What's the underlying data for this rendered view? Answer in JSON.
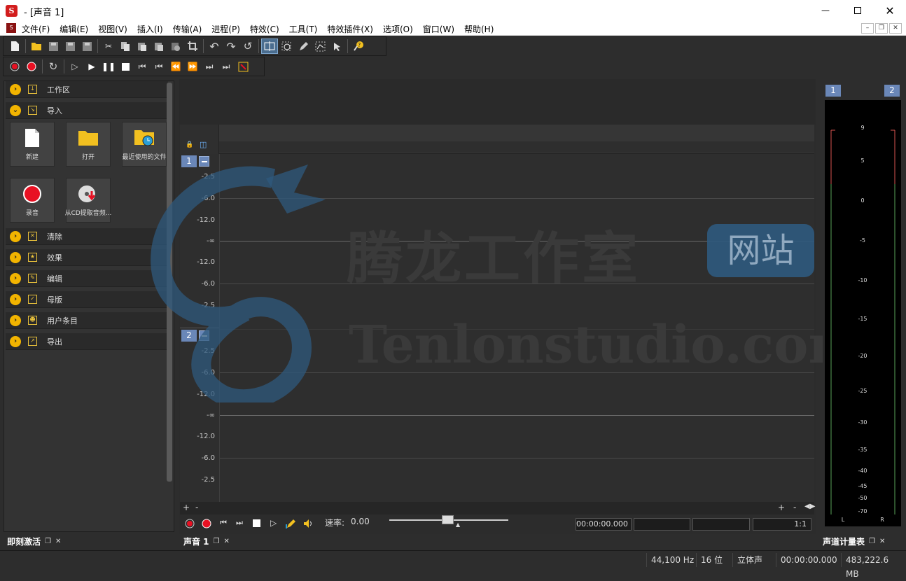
{
  "window": {
    "title": "- [声音 1]",
    "min_icon": "minimize-icon",
    "max_icon": "maximize-icon",
    "close_icon": "close-icon"
  },
  "menu": [
    "文件(F)",
    "编辑(E)",
    "视图(V)",
    "插入(I)",
    "传输(A)",
    "进程(P)",
    "特效(C)",
    "工具(T)",
    "特效插件(X)",
    "选项(O)",
    "窗口(W)",
    "帮助(H)"
  ],
  "toolbar1": [
    "new-file-icon",
    "open-folder-icon",
    "save-icon",
    "save-as-icon",
    "save-all-icon",
    "cut-icon",
    "copy-icon",
    "paste-icon",
    "paste-mix-icon",
    "paste-insert-icon",
    "crop-icon",
    "undo-icon",
    "redo-icon",
    "repeat-icon",
    "edit-tool-icon",
    "magnify-tool-icon",
    "pencil-tool-icon",
    "envelope-tool-icon",
    "select-tool-icon",
    "help-icon"
  ],
  "toolbar2": [
    "record-arm-icon",
    "record-icon",
    "loop-icon",
    "play-from-start-icon",
    "play-icon",
    "pause-icon",
    "stop-icon",
    "go-to-start-icon",
    "previous-marker-icon",
    "rewind-icon",
    "fast-forward-icon",
    "next-marker-icon",
    "go-to-end-icon",
    "snap-icon"
  ],
  "left_panel": {
    "sections_top": [
      {
        "label": "工作区",
        "chev": "›"
      },
      {
        "label": "导入",
        "chev": "⌄"
      }
    ],
    "tiles": [
      {
        "label": "新建",
        "icon": "new-document-icon"
      },
      {
        "label": "打开",
        "icon": "folder-icon"
      },
      {
        "label": "最近使用的文件",
        "icon": "recent-files-icon"
      },
      {
        "label": "录音",
        "icon": "record-icon"
      },
      {
        "label": "从CD提取音频...",
        "icon": "cd-extract-icon"
      }
    ],
    "sections_bottom": [
      {
        "label": "清除",
        "chev": "›"
      },
      {
        "label": "效果",
        "chev": "›"
      },
      {
        "label": "编辑",
        "chev": "›"
      },
      {
        "label": "母版",
        "chev": "›"
      },
      {
        "label": "用户条目",
        "chev": "›"
      },
      {
        "label": "导出",
        "chev": "›"
      }
    ],
    "tab_label": "即刻激活"
  },
  "tracks": {
    "channel1": "1",
    "channel2": "2",
    "db_labels_ch1": [
      "-2.5",
      "-6.0",
      "-12.0",
      "-∞",
      "-12.0",
      "-6.0",
      "-2.5"
    ],
    "db_labels_ch2": [
      "-2.5",
      "-6.0",
      "-12.0",
      "-∞",
      "-12.0",
      "-6.0",
      "-2.5"
    ]
  },
  "watermark": {
    "line1": "腾龙工作室",
    "badge": "网站",
    "line2": "Tenlonstudio.com"
  },
  "transport": {
    "rate_label": "速率:",
    "rate_value": "0.00",
    "time": "00:00:00.000",
    "ratio": "1:1",
    "zoom_plus": "+",
    "zoom_minus": "-"
  },
  "editor_tab": "声音 1",
  "meter": {
    "title": "声道计量表",
    "ch1": "1",
    "ch2": "2",
    "scale": [
      "9",
      "5",
      "0",
      "-5",
      "-10",
      "-15",
      "-20",
      "-25",
      "-30",
      "-35",
      "-40",
      "-45",
      "-50",
      "-70"
    ],
    "left": "L",
    "right": "R",
    "level_color": "#e04a4a",
    "line_color": "#55aa55"
  },
  "status": {
    "rate": "44,100 Hz",
    "bits": "16 位",
    "mode": "立体声",
    "time": "00:00:00.000",
    "space": "483,222.6 MB"
  }
}
